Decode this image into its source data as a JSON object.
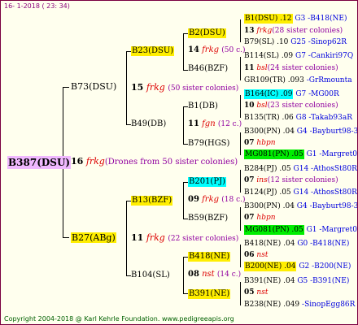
{
  "header": "16-  1-2018 ( 23: 34)",
  "footer": "Copyright 2004-2018 @ Karl Kehrle Foundation.   www.pedigreeapis.org",
  "root": {
    "name": "B387(DSU)",
    "num": "16",
    "tag": "frkg",
    "note": "(Drones from 50 sister colonies)"
  },
  "g1": [
    {
      "name": "B73(DSU)",
      "num": "15",
      "tag": "frkg",
      "note": "(50 sister colonies)"
    },
    {
      "name": "B27(ABg)",
      "num": "11",
      "tag": "frkg",
      "note": "(22 sister colonies)"
    }
  ],
  "g2": [
    {
      "name": "B23(DSU)",
      "num": "14",
      "tag": "frkg",
      "note": "(50 c.)"
    },
    {
      "name": "B49(DB)",
      "num": "11",
      "tag": "fgn",
      "note": "(12 c.)"
    },
    {
      "name": "B13(BZF)",
      "num": "09",
      "tag": "frkg",
      "note": "(18 c.)"
    },
    {
      "name": "B104(SL)",
      "num": "08",
      "tag": "nst",
      "note": "(14 c.)"
    }
  ],
  "g3": [
    {
      "name": "B2(DSU)",
      "num": "13",
      "tag": "frkg",
      "note": "(28 sister colonies)"
    },
    {
      "name": "B46(BZF)",
      "num": "11",
      "tag": "bsl",
      "note": "(24 sister colonies)"
    },
    {
      "name": "B1(DB)",
      "num": "10",
      "tag": "bsl",
      "note": "(23 sister colonies)"
    },
    {
      "name": "B79(HGS)",
      "num": "07",
      "tag": "hbpn",
      "note": ""
    },
    {
      "name": "B201(PJ)",
      "num": "07",
      "tag": "ins",
      "note": "(12 sister colonies)"
    },
    {
      "name": "B59(BZF)",
      "num": "07",
      "tag": "hbpn",
      "note": ""
    },
    {
      "name": "B418(NE)",
      "num": "06",
      "tag": "nst",
      "note": ""
    },
    {
      "name": "B391(NE)",
      "num": "05",
      "tag": "nst",
      "note": ""
    }
  ],
  "g4": [
    {
      "a": "B1(DSU) .12",
      "b": "G3 -B418(NE)"
    },
    {
      "a": "B79(SL) .10",
      "b": "G25 -Sinop62R"
    },
    {
      "a": "B114(SL) .09",
      "b": "G7 -Cankiri97Q"
    },
    {
      "a": "GR109(TR) .093",
      "b": "-GrRmounta"
    },
    {
      "a": "B164(IC) .09",
      "b": "G7 -MG00R"
    },
    {
      "a": "B135(TR) .06",
      "b": "G8 -Takab93aR"
    },
    {
      "a": "B300(PN) .04",
      "b": "G4 -Bayburt98-3"
    },
    {
      "a": "MG081(PN) .05",
      "b": "G1 -Margret04R"
    },
    {
      "a": "B284(PJ) .05",
      "b": "G14 -AthosSt80R"
    },
    {
      "a": "B124(PJ) .05",
      "b": "G14 -AthosSt80R"
    },
    {
      "a": "B300(PN) .04",
      "b": "G4 -Bayburt98-3"
    },
    {
      "a": "MG081(PN) .05",
      "b": "G1 -Margret04R"
    },
    {
      "a": "B418(NE) .04",
      "b": "G0 -B418(NE)"
    },
    {
      "a": "B200(NE) .04",
      "b": "G2 -B200(NE)"
    },
    {
      "a": "B391(NE) .04",
      "b": "G5 -B391(NE)"
    },
    {
      "a": "B238(NE) .049",
      "b": "-SinopEgg86R"
    }
  ],
  "colors": {
    "root_bg": "#f0b8ff",
    "yellow": "#ffee00",
    "cyan": "#00ffff",
    "green": "#00ee00",
    "tag": "#dd0000",
    "note": "#9000a0",
    "blue": "#0000dd"
  }
}
